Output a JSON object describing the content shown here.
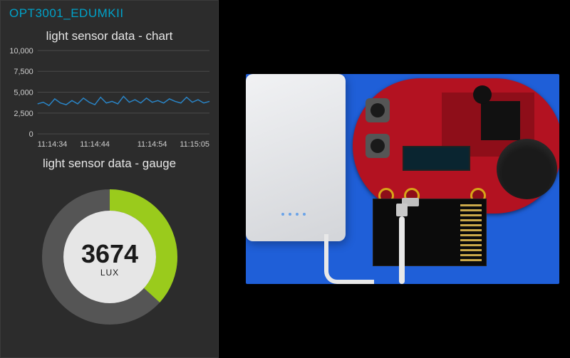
{
  "panel": {
    "title": "OPT3001_EDUMKII",
    "chart_title": "light sensor data - chart",
    "gauge_title": "light sensor data - gauge"
  },
  "gauge": {
    "value": 3674,
    "unit": "LUX",
    "min": 0,
    "max": 10000
  },
  "chart_data": {
    "type": "line",
    "title": "light sensor data - chart",
    "xlabel": "",
    "ylabel": "",
    "ylim": [
      0,
      10000
    ],
    "y_ticks": [
      0,
      2500,
      5000,
      7500,
      10000
    ],
    "y_tick_labels": [
      "0",
      "2,500",
      "5,000",
      "7,500",
      "10,000"
    ],
    "x_tick_labels": [
      "11:14:34",
      "11:14:44",
      "11:14:54",
      "11:15:05"
    ],
    "series": [
      {
        "name": "lux",
        "values": [
          3600,
          3800,
          3400,
          4200,
          3700,
          3500,
          4000,
          3600,
          4300,
          3800,
          3500,
          4400,
          3700,
          3900,
          3600,
          4500,
          3800,
          4100,
          3700,
          4300,
          3800,
          4000,
          3700,
          4200,
          3900,
          3700,
          4400,
          3800,
          4100,
          3700,
          3900
        ]
      }
    ]
  },
  "colors": {
    "accent": "#00a2c9",
    "line": "#2a85c7",
    "gauge_fill": "#9acb1c",
    "gauge_track": "#555555"
  }
}
